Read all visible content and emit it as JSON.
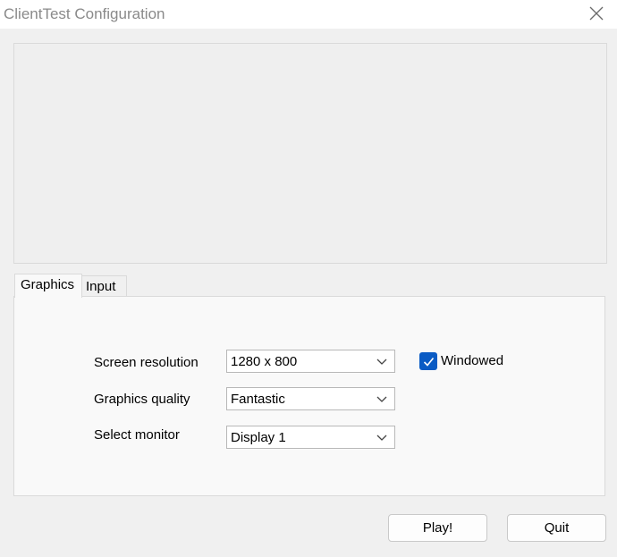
{
  "window": {
    "title": "ClientTest Configuration"
  },
  "tabs": [
    {
      "label": "Graphics",
      "selected": true
    },
    {
      "label": "Input",
      "selected": false
    }
  ],
  "graphics": {
    "screen_resolution": {
      "label": "Screen resolution",
      "value": "1280 x 800"
    },
    "graphics_quality": {
      "label": "Graphics quality",
      "value": "Fantastic"
    },
    "select_monitor": {
      "label": "Select monitor",
      "value": "Display 1"
    },
    "windowed": {
      "label": "Windowed",
      "checked": true
    }
  },
  "buttons": {
    "play": "Play!",
    "quit": "Quit"
  },
  "colors": {
    "accent": "#0a5bc4",
    "background": "#f0f0f0",
    "panel": "#f9f9f9"
  }
}
